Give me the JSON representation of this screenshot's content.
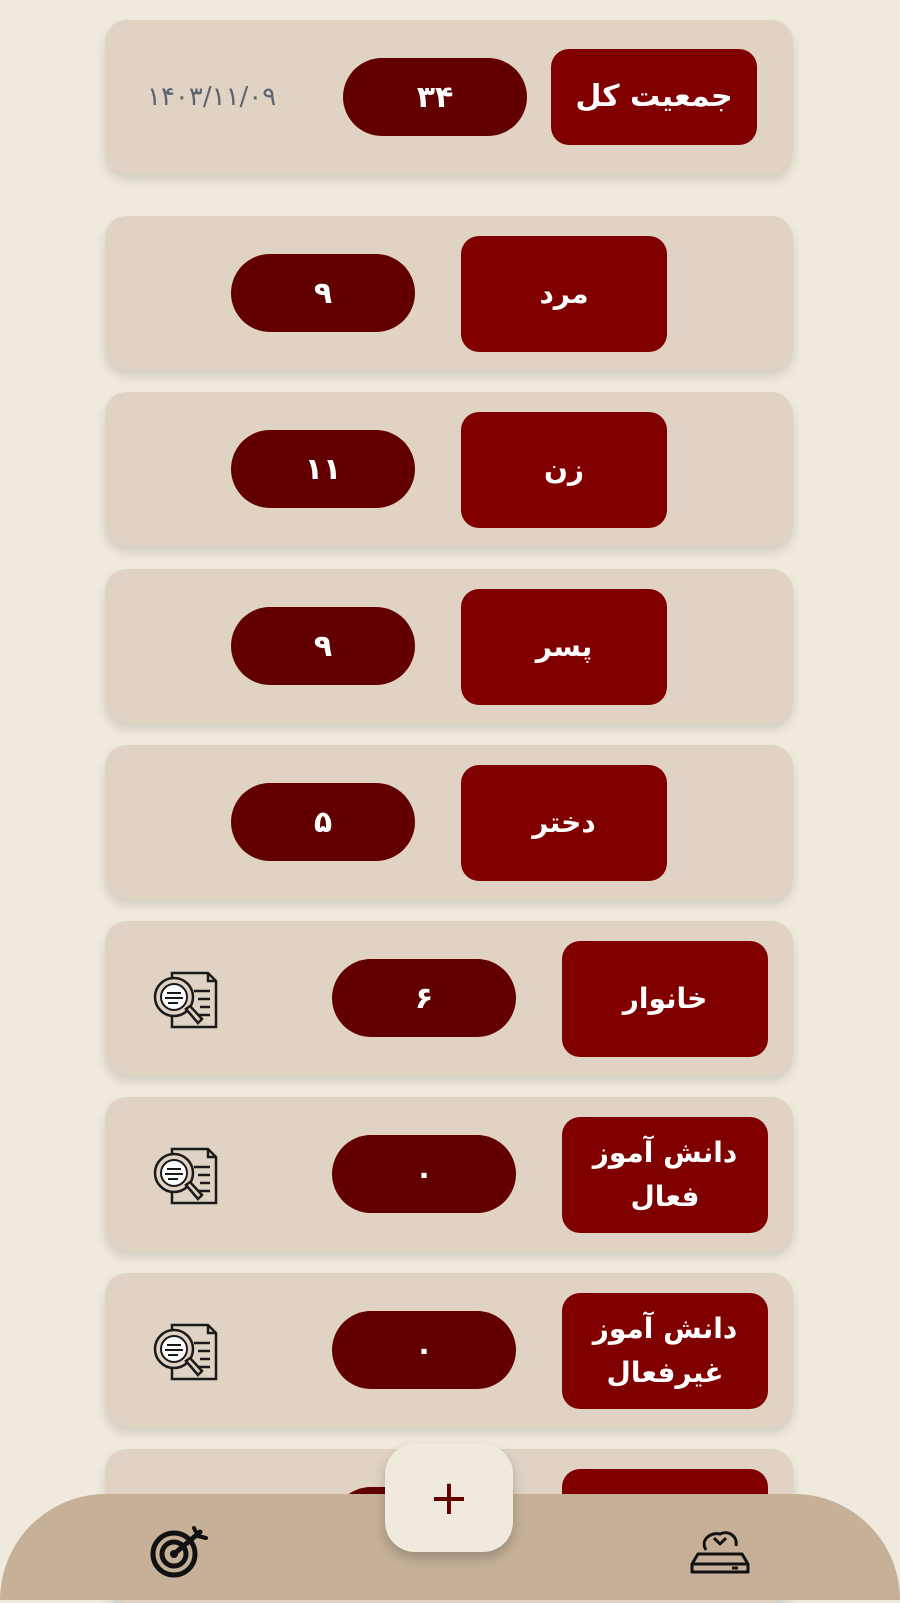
{
  "summary": {
    "label": "جمعیت کل",
    "count": "۳۴",
    "date": "۱۴۰۳/۱۱/۰۹"
  },
  "stats": [
    {
      "label": "مرد",
      "count": "۹"
    },
    {
      "label": "زن",
      "count": "۱۱"
    },
    {
      "label": "پسر",
      "count": "۹"
    },
    {
      "label": "دختر",
      "count": "۵"
    }
  ],
  "categories": [
    {
      "label": "خانوار",
      "count": "۶",
      "icon": "document-search-icon"
    },
    {
      "label": "دانش آموز فعال",
      "count": "۰",
      "icon": "document-search-icon"
    },
    {
      "label": "دانش آموز غیرفعال",
      "count": "۰",
      "icon": "document-search-icon"
    }
  ],
  "fab": {
    "label": "+"
  },
  "nav": {
    "left_icon": "target-icon",
    "right_icon": "cloud-sync-icon"
  },
  "colors": {
    "background": "#efeadd",
    "card": "#e0d3c3",
    "label_box": "#800000",
    "count_pill": "#620000",
    "nav_bar": "#c6b198"
  }
}
